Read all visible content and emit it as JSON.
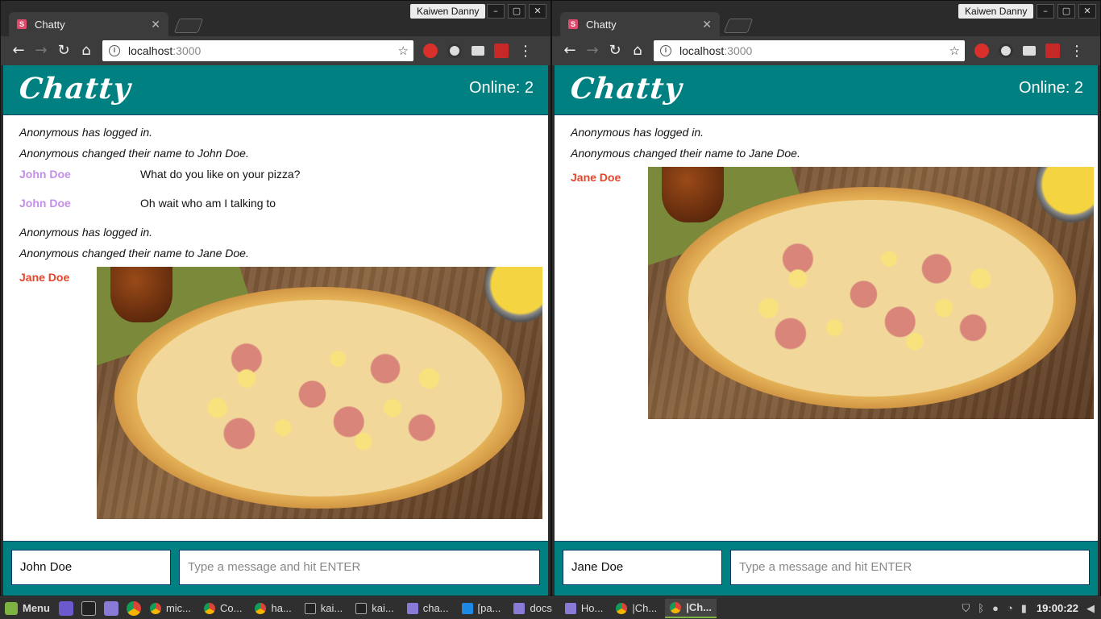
{
  "browser": {
    "tab_title": "Chatty",
    "tab_close": "✕",
    "profile_name": "Kaiwen Danny",
    "url_host": "localhost",
    "url_port": ":3000"
  },
  "app": {
    "brand": "Chatty",
    "online_label": "Online: 2",
    "message_placeholder": "Type a message and hit ENTER"
  },
  "left_window": {
    "current_user": "John Doe",
    "messages": [
      {
        "type": "system",
        "text": "Anonymous has logged in."
      },
      {
        "type": "system",
        "text": "Anonymous changed their name to John Doe."
      },
      {
        "type": "chat",
        "user": "John Doe",
        "text": "What do you like on your pizza?"
      },
      {
        "type": "chat",
        "user": "John Doe",
        "text": "Oh wait who am I talking to"
      },
      {
        "type": "system",
        "text": "Anonymous has logged in."
      },
      {
        "type": "system",
        "text": "Anonymous changed their name to Jane Doe."
      },
      {
        "type": "image",
        "user": "Jane Doe"
      }
    ]
  },
  "right_window": {
    "current_user": "Jane Doe",
    "messages": [
      {
        "type": "system",
        "text": "Anonymous has logged in."
      },
      {
        "type": "system",
        "text": "Anonymous changed their name to Jane Doe."
      },
      {
        "type": "image",
        "user": "Jane Doe"
      }
    ]
  },
  "colors": {
    "header": "#008080",
    "john_color": "#c38fe8",
    "jane_color": "#e8442a"
  },
  "taskbar": {
    "menu_label": "Menu",
    "items": [
      {
        "icon": "chrome",
        "label": "mic..."
      },
      {
        "icon": "chrome",
        "label": "Co..."
      },
      {
        "icon": "chrome",
        "label": "ha..."
      },
      {
        "icon": "terminal",
        "label": "kai..."
      },
      {
        "icon": "terminal",
        "label": "kai..."
      },
      {
        "icon": "folder",
        "label": "cha..."
      },
      {
        "icon": "code",
        "label": "[pa..."
      },
      {
        "icon": "folder",
        "label": "docs"
      },
      {
        "icon": "folder",
        "label": "Ho..."
      },
      {
        "icon": "chrome",
        "label": "|Ch..."
      },
      {
        "icon": "chrome",
        "label": "|Ch..."
      }
    ],
    "clock": "19:00:22"
  }
}
